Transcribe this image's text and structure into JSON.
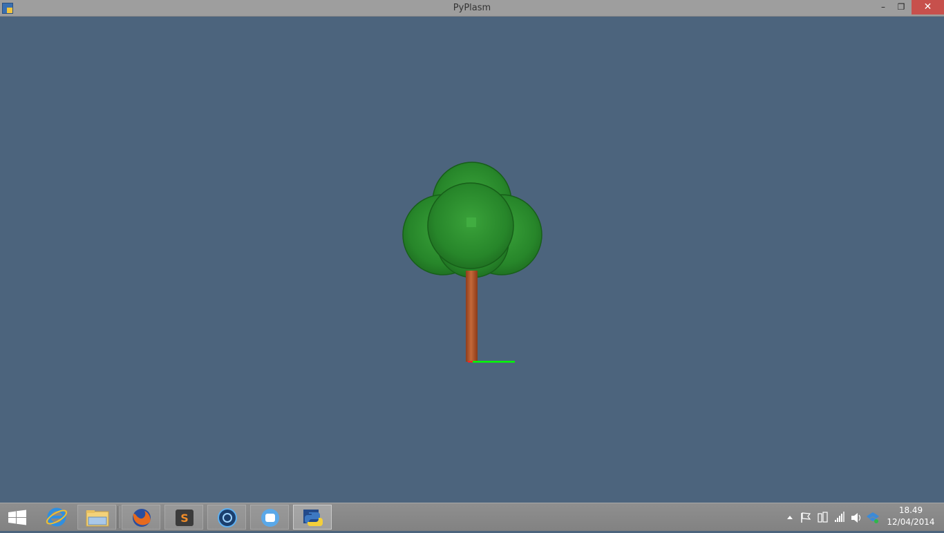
{
  "window": {
    "title": "PyPlasm",
    "minimize_label": "–",
    "maximize_label": "❐",
    "close_label": "✕"
  },
  "scene": {
    "background": "#4c647d",
    "foliage_color": "#2e8b2e",
    "trunk_color": "#b0532c",
    "axis_x_color": "#00ff00"
  },
  "taskbar": {
    "items": [
      "start-icon",
      "internet-explorer-icon",
      "file-explorer-icon",
      "firefox-icon",
      "sublime-text-icon",
      "media-icon",
      "chat-icon",
      "python-icon"
    ],
    "tray_icons": [
      "show-hidden-icons",
      "action-center-flag-icon",
      "device-icon",
      "network-signal-icon",
      "volume-icon",
      "dropbox-icon"
    ],
    "time": "18.49",
    "date": "12/04/2014"
  }
}
